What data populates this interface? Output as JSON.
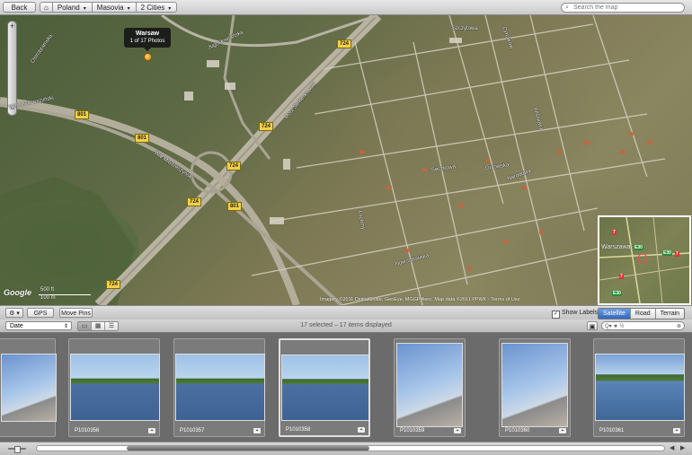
{
  "toolbar": {
    "back_label": "Back",
    "breadcrumbs": [
      {
        "label": "⌂",
        "icon": "home-icon"
      },
      {
        "label": "Poland"
      },
      {
        "label": "Masovia"
      },
      {
        "label": "2 Cities"
      }
    ],
    "search_placeholder": "Search the map"
  },
  "map": {
    "pin_title": "Warsaw",
    "pin_subtitle": "1 of 17 Photos",
    "road_shields": [
      "724",
      "724",
      "724",
      "724",
      "801",
      "801",
      "801",
      "724"
    ],
    "streets": [
      "Most Siekierkowski",
      "Wał Miedzeszyński",
      "Wał Miedzeszyński",
      "Jugosłowiańska",
      "Ostrobramska",
      "Nowositowska",
      "Lucerny",
      "Szczytowa",
      "Sęczkowa",
      "Gutowska",
      "Narodowa",
      "Wiśniowa",
      "Cyrulików"
    ],
    "scale_top": "500 ft",
    "scale_bottom": "100 m",
    "logo": "Google",
    "attribution": "Imagery ©2011 DigitalGlobe, GeoEye, MGGP Aero, Map data ©2011 PPWK - Terms of Use",
    "minimap_label": "Warszawa",
    "minimap_shields": [
      "7",
      "E30",
      "E30",
      "7",
      "E30",
      "7"
    ]
  },
  "mapbar": {
    "gear_label": "⚙ ▾",
    "gps_label": "GPS",
    "move_pins_label": "Move Pins",
    "show_labels_label": "Show Labels",
    "show_labels_checked": true,
    "map_types": [
      {
        "label": "Satellite",
        "active": true
      },
      {
        "label": "Road",
        "active": false
      },
      {
        "label": "Terrain",
        "active": false
      }
    ]
  },
  "browser": {
    "sort_value": "Date",
    "selection_status": "17 selected – 17 items displayed",
    "filter_placeholder": "Q▾ ★ ½"
  },
  "thumbnails": [
    {
      "caption": "",
      "kind": "bridge"
    },
    {
      "caption": "P1010356",
      "kind": "river"
    },
    {
      "caption": "P1010357",
      "kind": "river"
    },
    {
      "caption": "P1010358",
      "kind": "river"
    },
    {
      "caption": "P1010359",
      "kind": "bridge"
    },
    {
      "caption": "P1010360",
      "kind": "bridge"
    },
    {
      "caption": "P1010361",
      "kind": "ship"
    }
  ]
}
